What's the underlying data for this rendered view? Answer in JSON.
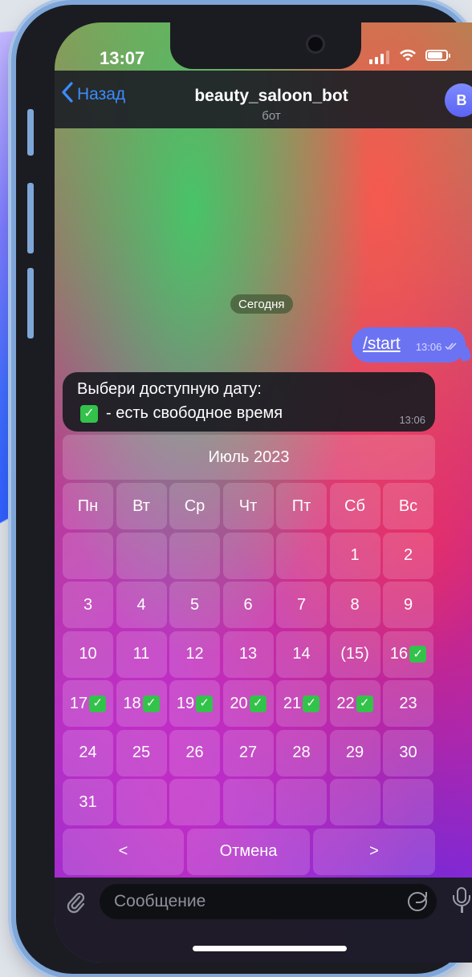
{
  "status_bar": {
    "time": "13:07"
  },
  "header": {
    "back_label": "Назад",
    "title": "beauty_saloon_bot",
    "subtitle": "бот",
    "avatar_letter": "B"
  },
  "chat": {
    "date_label": "Сегодня",
    "outgoing": {
      "text": "/start",
      "time": "13:06"
    },
    "incoming": {
      "line1": "Выбери доступную дату:",
      "line2": "- есть свободное время",
      "time": "13:06"
    }
  },
  "calendar": {
    "month_label": "Июль 2023",
    "weekdays": [
      "Пн",
      "Вт",
      "Ср",
      "Чт",
      "Пт",
      "Сб",
      "Вс"
    ],
    "rows": [
      [
        {
          "t": ""
        },
        {
          "t": ""
        },
        {
          "t": ""
        },
        {
          "t": ""
        },
        {
          "t": ""
        },
        {
          "t": "1"
        },
        {
          "t": "2"
        }
      ],
      [
        {
          "t": "3"
        },
        {
          "t": "4"
        },
        {
          "t": "5"
        },
        {
          "t": "6"
        },
        {
          "t": "7"
        },
        {
          "t": "8"
        },
        {
          "t": "9"
        }
      ],
      [
        {
          "t": "10"
        },
        {
          "t": "11"
        },
        {
          "t": "12"
        },
        {
          "t": "13"
        },
        {
          "t": "14"
        },
        {
          "t": "(15)"
        },
        {
          "t": "16",
          "avail": true
        }
      ],
      [
        {
          "t": "17",
          "avail": true
        },
        {
          "t": "18",
          "avail": true
        },
        {
          "t": "19",
          "avail": true
        },
        {
          "t": "20",
          "avail": true
        },
        {
          "t": "21",
          "avail": true
        },
        {
          "t": "22",
          "avail": true
        },
        {
          "t": "23"
        }
      ],
      [
        {
          "t": "24"
        },
        {
          "t": "25"
        },
        {
          "t": "26"
        },
        {
          "t": "27"
        },
        {
          "t": "28"
        },
        {
          "t": "29"
        },
        {
          "t": "30"
        }
      ],
      [
        {
          "t": "31"
        },
        {
          "t": ""
        },
        {
          "t": ""
        },
        {
          "t": ""
        },
        {
          "t": ""
        },
        {
          "t": ""
        },
        {
          "t": ""
        }
      ]
    ],
    "nav": {
      "prev": "<",
      "cancel": "Отмена",
      "next": ">"
    }
  },
  "composer": {
    "placeholder": "Сообщение"
  },
  "icons": {
    "back": "chevron-left-icon",
    "attach": "paperclip-icon",
    "sticker": "sticker-icon",
    "mic": "microphone-icon",
    "read": "double-check-icon",
    "available": "check-mark-icon"
  },
  "colors": {
    "accent": "#3b8cff",
    "outgoing_bubble": "#6c73f2",
    "check": "#33c24a"
  }
}
